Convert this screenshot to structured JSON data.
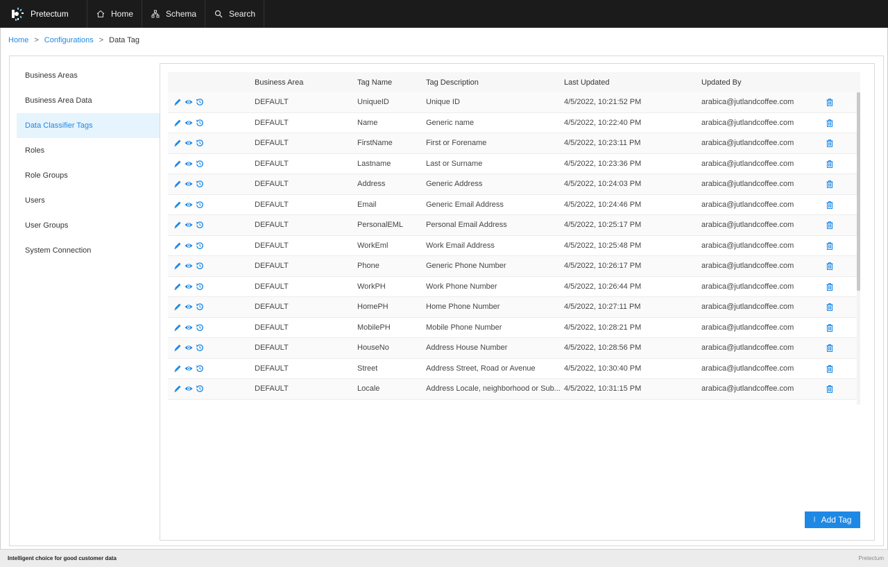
{
  "app": {
    "name": "Pretectum"
  },
  "nav": [
    {
      "label": "Home",
      "icon": "home-icon"
    },
    {
      "label": "Schema",
      "icon": "schema-icon"
    },
    {
      "label": "Search",
      "icon": "search-icon"
    }
  ],
  "breadcrumb": {
    "home": "Home",
    "configurations": "Configurations",
    "current": "Data Tag",
    "separator": ">"
  },
  "sidebar": {
    "items": [
      {
        "label": "Business Areas",
        "active": false
      },
      {
        "label": "Business Area Data",
        "active": false
      },
      {
        "label": "Data Classifier Tags",
        "active": true
      },
      {
        "label": "Roles",
        "active": false
      },
      {
        "label": "Role Groups",
        "active": false
      },
      {
        "label": "Users",
        "active": false
      },
      {
        "label": "User Groups",
        "active": false
      },
      {
        "label": "System Connection",
        "active": false
      }
    ]
  },
  "table": {
    "columns": [
      "",
      "Business Area",
      "Tag Name",
      "Tag Description",
      "Last Updated",
      "Updated By",
      ""
    ],
    "rows": [
      {
        "area": "DEFAULT",
        "name": "UniqueID",
        "desc": "Unique ID",
        "updated": "4/5/2022, 10:21:52 PM",
        "by": "arabica@jutlandcoffee.com"
      },
      {
        "area": "DEFAULT",
        "name": "Name",
        "desc": "Generic name",
        "updated": "4/5/2022, 10:22:40 PM",
        "by": "arabica@jutlandcoffee.com"
      },
      {
        "area": "DEFAULT",
        "name": "FirstName",
        "desc": "First or Forename",
        "updated": "4/5/2022, 10:23:11 PM",
        "by": "arabica@jutlandcoffee.com"
      },
      {
        "area": "DEFAULT",
        "name": "Lastname",
        "desc": "Last or Surname",
        "updated": "4/5/2022, 10:23:36 PM",
        "by": "arabica@jutlandcoffee.com"
      },
      {
        "area": "DEFAULT",
        "name": "Address",
        "desc": "Generic Address",
        "updated": "4/5/2022, 10:24:03 PM",
        "by": "arabica@jutlandcoffee.com"
      },
      {
        "area": "DEFAULT",
        "name": "Email",
        "desc": "Generic Email Address",
        "updated": "4/5/2022, 10:24:46 PM",
        "by": "arabica@jutlandcoffee.com"
      },
      {
        "area": "DEFAULT",
        "name": "PersonalEML",
        "desc": "Personal Email Address",
        "updated": "4/5/2022, 10:25:17 PM",
        "by": "arabica@jutlandcoffee.com"
      },
      {
        "area": "DEFAULT",
        "name": "WorkEml",
        "desc": "Work Email Address",
        "updated": "4/5/2022, 10:25:48 PM",
        "by": "arabica@jutlandcoffee.com"
      },
      {
        "area": "DEFAULT",
        "name": "Phone",
        "desc": "Generic Phone Number",
        "updated": "4/5/2022, 10:26:17 PM",
        "by": "arabica@jutlandcoffee.com"
      },
      {
        "area": "DEFAULT",
        "name": "WorkPH",
        "desc": "Work Phone Number",
        "updated": "4/5/2022, 10:26:44 PM",
        "by": "arabica@jutlandcoffee.com"
      },
      {
        "area": "DEFAULT",
        "name": "HomePH",
        "desc": "Home Phone Number",
        "updated": "4/5/2022, 10:27:11 PM",
        "by": "arabica@jutlandcoffee.com"
      },
      {
        "area": "DEFAULT",
        "name": "MobilePH",
        "desc": "Mobile Phone Number",
        "updated": "4/5/2022, 10:28:21 PM",
        "by": "arabica@jutlandcoffee.com"
      },
      {
        "area": "DEFAULT",
        "name": "HouseNo",
        "desc": "Address House Number",
        "updated": "4/5/2022, 10:28:56 PM",
        "by": "arabica@jutlandcoffee.com"
      },
      {
        "area": "DEFAULT",
        "name": "Street",
        "desc": "Address Street, Road or Avenue",
        "updated": "4/5/2022, 10:30:40 PM",
        "by": "arabica@jutlandcoffee.com"
      },
      {
        "area": "DEFAULT",
        "name": "Locale",
        "desc": "Address Locale, neighborhood or Sub...",
        "updated": "4/5/2022, 10:31:15 PM",
        "by": "arabica@jutlandcoffee.com"
      }
    ]
  },
  "actions": {
    "add_tag": "Add Tag",
    "add_prefix": "I"
  },
  "footer": {
    "tagline": "Intelligent choice for good customer data",
    "brand": "Pretectum"
  },
  "colors": {
    "accent": "#1e88e5",
    "topbar": "#1b1b1b",
    "active_bg": "#e6f4fd"
  }
}
